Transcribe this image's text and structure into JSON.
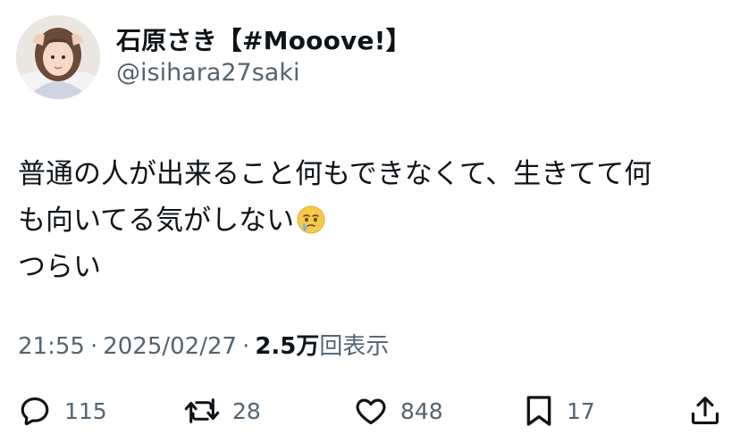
{
  "user": {
    "display_name": "石原さき【#Mooove!】",
    "handle": "@isihara27saki",
    "avatar": "profile-photo"
  },
  "tweet": {
    "lines": [
      "普通の人が出来ること何もできなくて、生きてて何",
      "も向いてる気がしない",
      "つらい"
    ],
    "emoji": "face-holding-back-tears"
  },
  "meta": {
    "time": "21:55",
    "separator": "·",
    "date": "2025/02/27",
    "views_count": "2.5万",
    "views_label": "回表示"
  },
  "actions": {
    "reply": {
      "icon": "reply-icon",
      "count": "115"
    },
    "retweet": {
      "icon": "retweet-icon",
      "count": "28"
    },
    "like": {
      "icon": "heart-icon",
      "count": "848"
    },
    "bookmark": {
      "icon": "bookmark-icon",
      "count": "17"
    },
    "share": {
      "icon": "share-icon"
    }
  },
  "colors": {
    "text": "#0f1419",
    "secondary": "#536471",
    "background": "#ffffff"
  }
}
